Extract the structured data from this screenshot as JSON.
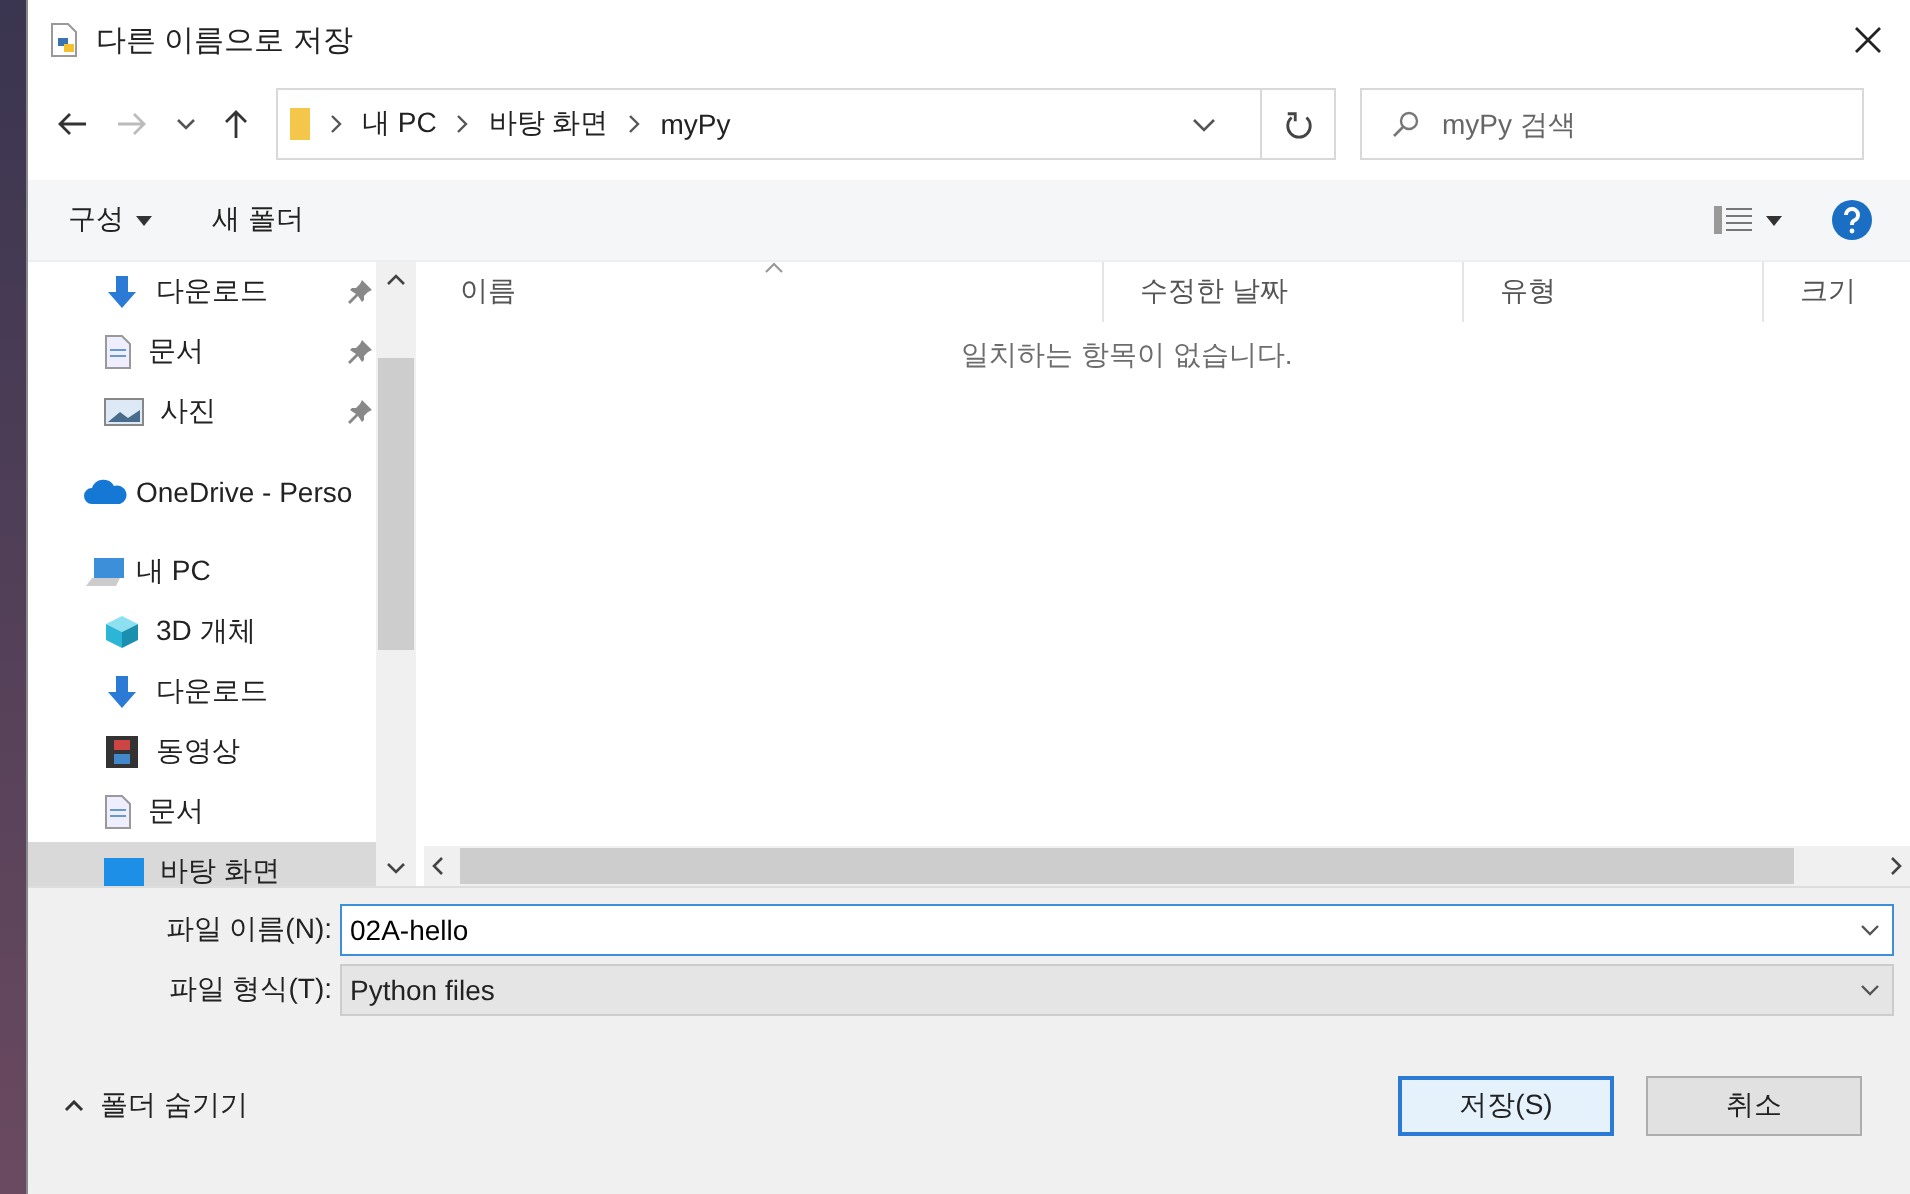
{
  "window": {
    "title": "다른 이름으로 저장"
  },
  "nav": {
    "breadcrumbs": [
      "내 PC",
      "바탕 화면",
      "myPy"
    ],
    "search": {
      "placeholder": "myPy 검색"
    }
  },
  "toolbar": {
    "organize": "구성",
    "new_folder": "새 폴더"
  },
  "sidebar": {
    "items": [
      {
        "label": "다운로드",
        "kind": "download",
        "pinned": true,
        "selected": false
      },
      {
        "label": "문서",
        "kind": "document",
        "pinned": true,
        "selected": false
      },
      {
        "label": "사진",
        "kind": "photo",
        "pinned": true,
        "selected": false
      },
      {
        "label": "OneDrive - Perso",
        "kind": "cloud",
        "selected": false
      },
      {
        "label": "내 PC",
        "kind": "pc",
        "selected": false,
        "children": [
          {
            "label": "3D 개체",
            "kind": "cube",
            "selected": false
          },
          {
            "label": "다운로드",
            "kind": "download",
            "selected": false
          },
          {
            "label": "동영상",
            "kind": "film",
            "selected": false
          },
          {
            "label": "문서",
            "kind": "document",
            "selected": false
          },
          {
            "label": "바탕 화면",
            "kind": "desktop",
            "selected": true
          }
        ]
      }
    ]
  },
  "table": {
    "columns": [
      "이름",
      "수정한 날짜",
      "유형",
      "크기"
    ],
    "empty_message": "일치하는 항목이 없습니다."
  },
  "form": {
    "file_name": {
      "label": "파일 이름(N):",
      "value": "02A-hello"
    },
    "file_type": {
      "label": "파일 형식(T):",
      "value": "Python files"
    }
  },
  "hide_folders": "폴더 숨기기",
  "buttons": [
    {
      "label": "저장(S)",
      "kind": "primary"
    },
    {
      "label": "취소",
      "kind": "normal"
    }
  ]
}
